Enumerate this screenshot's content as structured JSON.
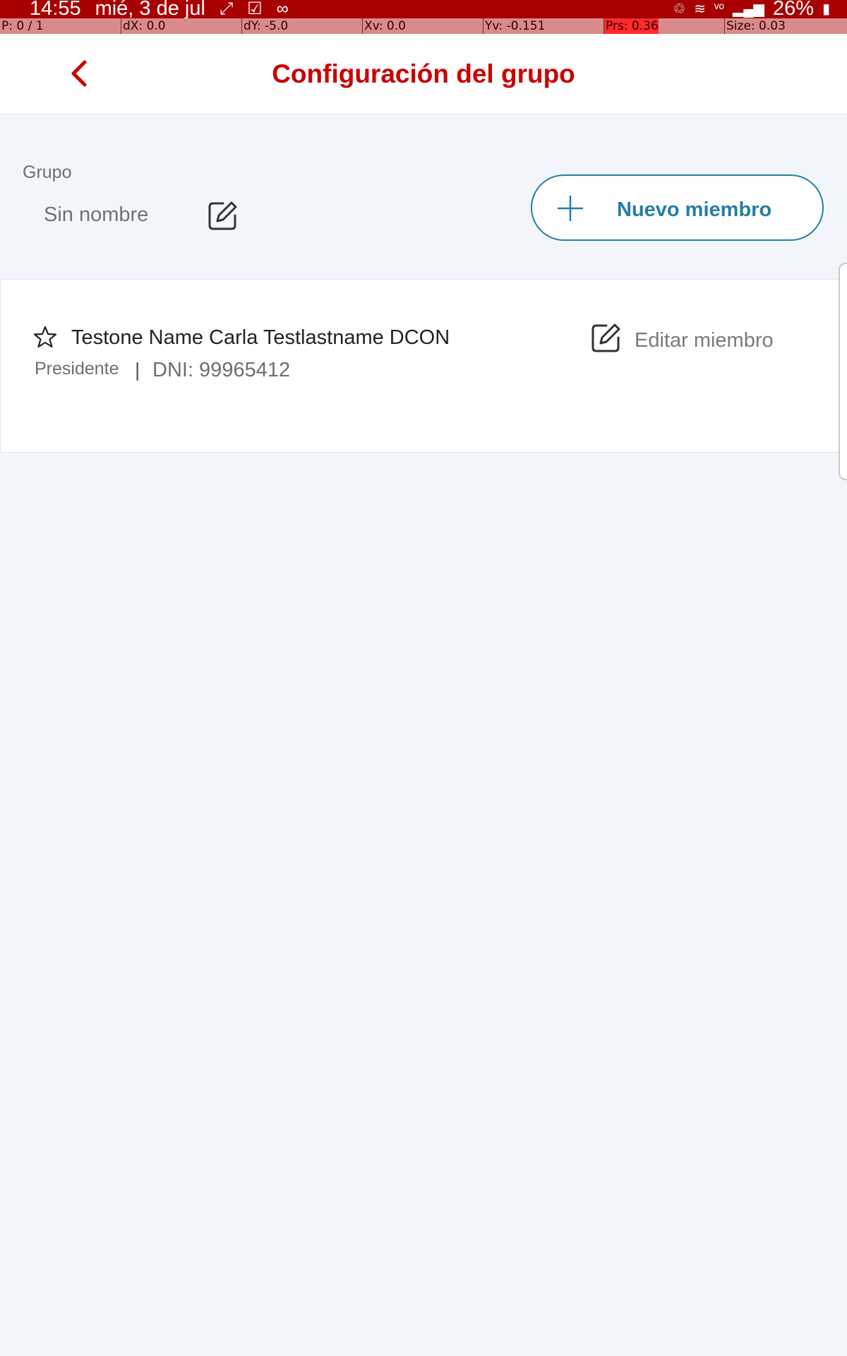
{
  "status_bar": {
    "time": "14:55",
    "date": "mié, 3 de jul",
    "battery": "26%",
    "left_icons": [
      "nfc-icon",
      "checkbox-icon",
      "voicemail-icon"
    ],
    "right_icons": [
      "battery-saver-icon",
      "wifi-icon",
      "volte-icon",
      "signal-icon",
      "battery-charging-icon"
    ]
  },
  "debug_overlay": {
    "p": "P: 0 / 1",
    "dx": "dX: 0.0",
    "dy": "dY: -5.0",
    "xv": "Xv: 0.0",
    "yv": "Yv: -0.151",
    "prs": "Prs: 0.36",
    "size": "Size: 0.03"
  },
  "header": {
    "title": "Configuración del grupo",
    "back_icon": "chevron-left-icon"
  },
  "group": {
    "label": "Grupo",
    "name": "Sin nombre",
    "edit_icon": "edit-icon"
  },
  "new_member_button": {
    "label": "Nuevo miembro",
    "icon": "plus-icon"
  },
  "members": [
    {
      "name": "Testone Name Carla Testlastname DCON",
      "role": "Presidente",
      "separator": "|",
      "dni": "DNI: 99965412",
      "edit_label": "Editar miembro",
      "icon": "star-outline-icon"
    }
  ],
  "colors": {
    "brand_red": "#cc0000",
    "accent_blue": "#257fa4",
    "background": "#f2f6fa",
    "status_bar": "#a80000"
  }
}
